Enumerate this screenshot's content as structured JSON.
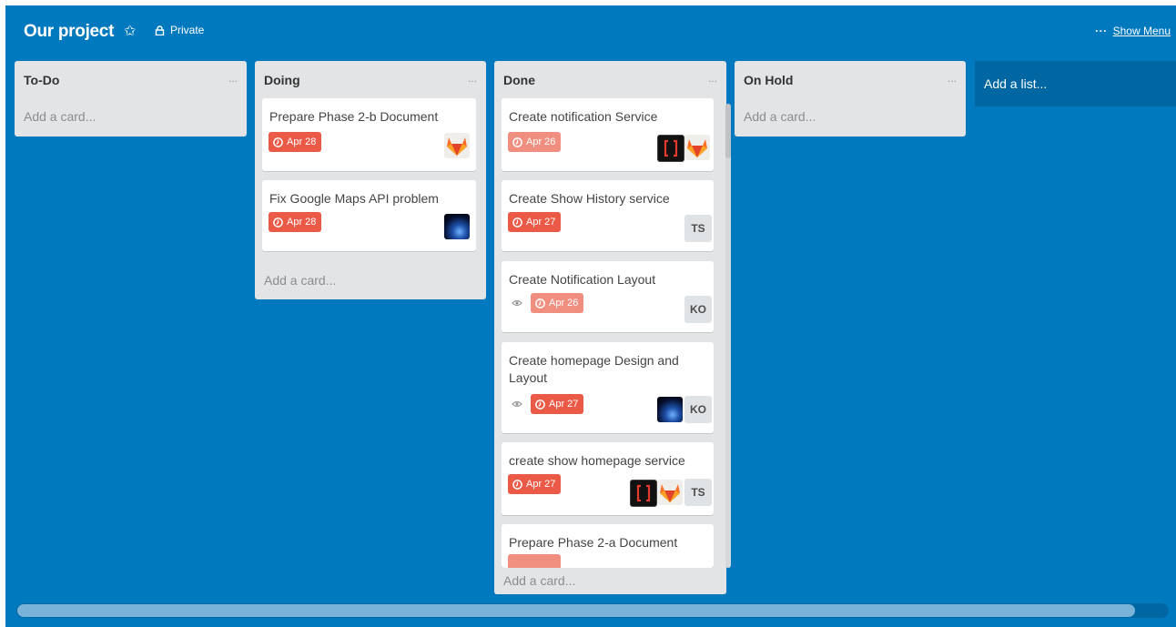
{
  "board": {
    "title": "Our project",
    "visibility": "Private",
    "show_menu_label": "Show Menu",
    "add_list_label": "Add a list..."
  },
  "colors": {
    "board_bg": "#0079bf",
    "list_bg": "#e2e4e6",
    "due_overdue": "#eb5a46",
    "due_past": "#f08f80"
  },
  "lists": [
    {
      "title": "To-Do",
      "add_card": "Add a card..."
    },
    {
      "title": "Doing",
      "add_card": "Add a card...",
      "cards": [
        {
          "title": "Prepare Phase 2-b Document",
          "due": "Apr 28",
          "members": [
            "gitlab-avatar"
          ]
        },
        {
          "title": "Fix Google Maps API problem",
          "due": "Apr 28",
          "members": [
            "earth-avatar"
          ]
        }
      ]
    },
    {
      "title": "Done",
      "add_card": "Add a card...",
      "cards": [
        {
          "title": "Create notification Service",
          "due": "Apr 26",
          "members": [
            "brackets-avatar",
            "gitlab-avatar"
          ]
        },
        {
          "title": "Create Show History service",
          "due": "Apr 27",
          "members": [
            "TS"
          ]
        },
        {
          "title": "Create Notification Layout",
          "due": "Apr 26",
          "watching": true,
          "members": [
            "KO"
          ]
        },
        {
          "title": "Create homepage Design and Layout",
          "due": "Apr 27",
          "watching": true,
          "members": [
            "earth-avatar",
            "KO"
          ]
        },
        {
          "title": "create show homepage service",
          "due": "Apr 27",
          "members": [
            "brackets-avatar",
            "gitlab-avatar",
            "TS"
          ]
        },
        {
          "title": "Prepare Phase 2-a Document"
        }
      ]
    },
    {
      "title": "On Hold",
      "add_card": "Add a card..."
    }
  ],
  "initials": {
    "ts": "TS",
    "ko": "KO"
  },
  "menu_glyph": "..."
}
